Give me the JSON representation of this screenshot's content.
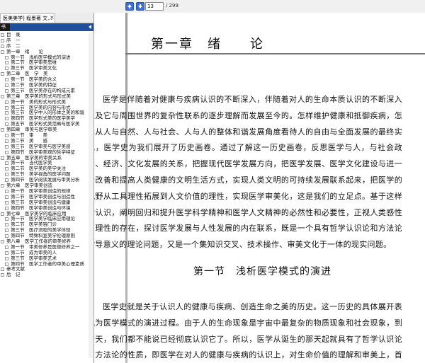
{
  "toolbar": {
    "prev_icon": "arrow-up-icon",
    "next_icon": "arrow-down-icon",
    "page_current": "13",
    "page_total": "/ 299"
  },
  "left_panel": {
    "tab_title": "医美美学] 程墨著 文...",
    "tab_close": "×",
    "header_label": "书",
    "items": [
      {
        "indent": 0,
        "label": "目　录"
      },
      {
        "indent": 0,
        "label": "序　一"
      },
      {
        "indent": 0,
        "label": "序　二"
      },
      {
        "indent": 0,
        "label": "第一章　绪　　论"
      },
      {
        "indent": 1,
        "label": "第一节　浅析医学模式的演进"
      },
      {
        "indent": 1,
        "label": "第二节　医学审美思维"
      },
      {
        "indent": 1,
        "label": "第三节　医学审美文化"
      },
      {
        "indent": 0,
        "label": "第二章　医　学　美"
      },
      {
        "indent": 1,
        "label": "第一节　医学美的含义"
      },
      {
        "indent": 1,
        "label": "第二节　医学美的特征"
      },
      {
        "indent": 1,
        "label": "第三节　医学美存在的构成元素"
      },
      {
        "indent": 0,
        "label": "第三章　医学美的形式与形式美"
      },
      {
        "indent": 1,
        "label": "第一节　美的形式与形式美"
      },
      {
        "indent": 1,
        "label": "第二节　医学美的内容与形式"
      },
      {
        "indent": 1,
        "label": "第三节　医学中人的形体之美的和谐"
      },
      {
        "indent": 1,
        "label": "第四节　医学形式美的医学美学"
      },
      {
        "indent": 1,
        "label": "第五节　医学形式美范畴与医学美"
      },
      {
        "indent": 0,
        "label": "第四章　审美与医学审美"
      },
      {
        "indent": 1,
        "label": "第一节　审　　美"
      },
      {
        "indent": 1,
        "label": "第二节　美　　感"
      },
      {
        "indent": 1,
        "label": "第三节　医学审美与医学美感"
      },
      {
        "indent": 1,
        "label": "第四节　医学审美观的哲学特征"
      },
      {
        "indent": 0,
        "label": "第五章　医学美的审美关系"
      },
      {
        "indent": 1,
        "label": "第一节　当代医学美"
      },
      {
        "indent": 1,
        "label": "第二节　医学美的美学关注"
      },
      {
        "indent": 1,
        "label": "第三节　美学视角的医学问题"
      },
      {
        "indent": 1,
        "label": "第四节　医学阅读发展与审美分析"
      },
      {
        "indent": 0,
        "label": "第六章　医学审美创造"
      },
      {
        "indent": 1,
        "label": "第一节　医学审美创造的规律"
      },
      {
        "indent": 1,
        "label": "第二节　医学审美创造与创造性"
      },
      {
        "indent": 1,
        "label": "第三节　医学审美创造与健康"
      },
      {
        "indent": 1,
        "label": "第四节　医学审美创造与环境"
      },
      {
        "indent": 0,
        "label": "第七章　医学美学的临床应用"
      },
      {
        "indent": 1,
        "label": "第一节　医学美学临床应用理论"
      },
      {
        "indent": 1,
        "label": "第二节　医学美容门诊"
      },
      {
        "indent": 1,
        "label": "第三节　医疗流程的美学体现"
      },
      {
        "indent": 1,
        "label": "第四节　特殊科室美学伦理原则"
      },
      {
        "indent": 0,
        "label": "第八章　医学工作者的审美修养"
      },
      {
        "indent": 1,
        "label": "第一节　审美修养是医德修养之一"
      },
      {
        "indent": 1,
        "label": "第二节　成为审美的人"
      },
      {
        "indent": 1,
        "label": "第三节　医学审美艺术"
      },
      {
        "indent": 1,
        "label": "第四节　医学工作者的审美心理素质"
      },
      {
        "indent": 0,
        "label": "参考文献"
      },
      {
        "indent": 0,
        "label": "后　记"
      }
    ]
  },
  "main": {
    "chapter_title": "第一章　绪　　论",
    "para1": "医学是伴随着对健康与疾病认识的不断深入，伴随着对人的生命本质认识的不断深入以及它与周围世界的复杂性联系的逐步理解而发展至今的。怎样维护健康和抵御疾病，怎样从人与自然、人与社会、人与人的整体和谐发展角度看待人的自由与全面发展的最终实现，医学史为我们展开了历史画卷。通过了解这一历史画卷，反思医学与人，与社会政治、经济、文化发展的关系，把握现代医学发展方向，把医学发展、医学文化建设与进一步改善和提高人类健康的文明生活方式，实现人类文明的可持续发展联系起来，把医学的视野从工具理性拓展到人文价值的理性，实现医学审美化，这是我们的立足点。基于这样的认识，阐明回归和提升医学科学精神和医学人文精神的必然性和必要性，正视人类感性与理性的存在，探讨医学发展与人性发展的内在联系，既是一个具有哲学认识论和方法论指导意义的理论问题，又是一个集知识交叉、技术操作、审美文化于一体的现实问题。",
    "section_title": "第一节　浅析医学模式的演进",
    "para2": "医学史就是关于认识人的健康与疾病、创造生命之美的历史。这一历史的具体展开表现为医学模式的演进过程。由于人的生命现象是宇宙中最复杂的物质现象和社会现象，到今天，我们都不能说已经彻底认识它了。所以，医学从诞生的那天起就具有了哲学认识论和方法论的性质，即医学在对人的健康与疾病的认识上，对生命价值的理解和审美上，首先涉及的是一种用什么观点和方法去"
  }
}
